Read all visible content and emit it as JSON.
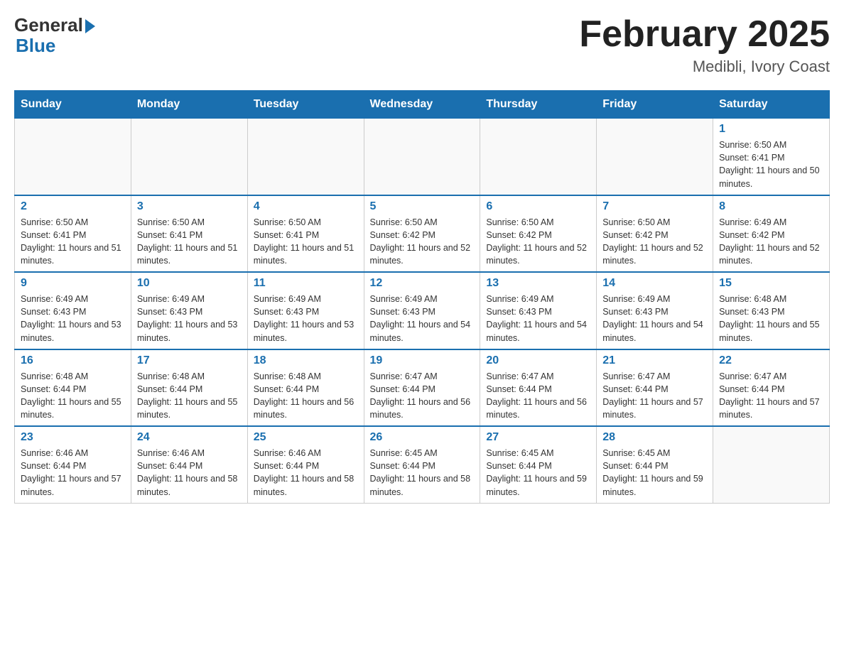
{
  "header": {
    "logo_general": "General",
    "logo_blue": "Blue",
    "title": "February 2025",
    "subtitle": "Medibli, Ivory Coast"
  },
  "days_of_week": [
    "Sunday",
    "Monday",
    "Tuesday",
    "Wednesday",
    "Thursday",
    "Friday",
    "Saturday"
  ],
  "weeks": [
    [
      {
        "day": "",
        "info": ""
      },
      {
        "day": "",
        "info": ""
      },
      {
        "day": "",
        "info": ""
      },
      {
        "day": "",
        "info": ""
      },
      {
        "day": "",
        "info": ""
      },
      {
        "day": "",
        "info": ""
      },
      {
        "day": "1",
        "info": "Sunrise: 6:50 AM\nSunset: 6:41 PM\nDaylight: 11 hours and 50 minutes."
      }
    ],
    [
      {
        "day": "2",
        "info": "Sunrise: 6:50 AM\nSunset: 6:41 PM\nDaylight: 11 hours and 51 minutes."
      },
      {
        "day": "3",
        "info": "Sunrise: 6:50 AM\nSunset: 6:41 PM\nDaylight: 11 hours and 51 minutes."
      },
      {
        "day": "4",
        "info": "Sunrise: 6:50 AM\nSunset: 6:41 PM\nDaylight: 11 hours and 51 minutes."
      },
      {
        "day": "5",
        "info": "Sunrise: 6:50 AM\nSunset: 6:42 PM\nDaylight: 11 hours and 52 minutes."
      },
      {
        "day": "6",
        "info": "Sunrise: 6:50 AM\nSunset: 6:42 PM\nDaylight: 11 hours and 52 minutes."
      },
      {
        "day": "7",
        "info": "Sunrise: 6:50 AM\nSunset: 6:42 PM\nDaylight: 11 hours and 52 minutes."
      },
      {
        "day": "8",
        "info": "Sunrise: 6:49 AM\nSunset: 6:42 PM\nDaylight: 11 hours and 52 minutes."
      }
    ],
    [
      {
        "day": "9",
        "info": "Sunrise: 6:49 AM\nSunset: 6:43 PM\nDaylight: 11 hours and 53 minutes."
      },
      {
        "day": "10",
        "info": "Sunrise: 6:49 AM\nSunset: 6:43 PM\nDaylight: 11 hours and 53 minutes."
      },
      {
        "day": "11",
        "info": "Sunrise: 6:49 AM\nSunset: 6:43 PM\nDaylight: 11 hours and 53 minutes."
      },
      {
        "day": "12",
        "info": "Sunrise: 6:49 AM\nSunset: 6:43 PM\nDaylight: 11 hours and 54 minutes."
      },
      {
        "day": "13",
        "info": "Sunrise: 6:49 AM\nSunset: 6:43 PM\nDaylight: 11 hours and 54 minutes."
      },
      {
        "day": "14",
        "info": "Sunrise: 6:49 AM\nSunset: 6:43 PM\nDaylight: 11 hours and 54 minutes."
      },
      {
        "day": "15",
        "info": "Sunrise: 6:48 AM\nSunset: 6:43 PM\nDaylight: 11 hours and 55 minutes."
      }
    ],
    [
      {
        "day": "16",
        "info": "Sunrise: 6:48 AM\nSunset: 6:44 PM\nDaylight: 11 hours and 55 minutes."
      },
      {
        "day": "17",
        "info": "Sunrise: 6:48 AM\nSunset: 6:44 PM\nDaylight: 11 hours and 55 minutes."
      },
      {
        "day": "18",
        "info": "Sunrise: 6:48 AM\nSunset: 6:44 PM\nDaylight: 11 hours and 56 minutes."
      },
      {
        "day": "19",
        "info": "Sunrise: 6:47 AM\nSunset: 6:44 PM\nDaylight: 11 hours and 56 minutes."
      },
      {
        "day": "20",
        "info": "Sunrise: 6:47 AM\nSunset: 6:44 PM\nDaylight: 11 hours and 56 minutes."
      },
      {
        "day": "21",
        "info": "Sunrise: 6:47 AM\nSunset: 6:44 PM\nDaylight: 11 hours and 57 minutes."
      },
      {
        "day": "22",
        "info": "Sunrise: 6:47 AM\nSunset: 6:44 PM\nDaylight: 11 hours and 57 minutes."
      }
    ],
    [
      {
        "day": "23",
        "info": "Sunrise: 6:46 AM\nSunset: 6:44 PM\nDaylight: 11 hours and 57 minutes."
      },
      {
        "day": "24",
        "info": "Sunrise: 6:46 AM\nSunset: 6:44 PM\nDaylight: 11 hours and 58 minutes."
      },
      {
        "day": "25",
        "info": "Sunrise: 6:46 AM\nSunset: 6:44 PM\nDaylight: 11 hours and 58 minutes."
      },
      {
        "day": "26",
        "info": "Sunrise: 6:45 AM\nSunset: 6:44 PM\nDaylight: 11 hours and 58 minutes."
      },
      {
        "day": "27",
        "info": "Sunrise: 6:45 AM\nSunset: 6:44 PM\nDaylight: 11 hours and 59 minutes."
      },
      {
        "day": "28",
        "info": "Sunrise: 6:45 AM\nSunset: 6:44 PM\nDaylight: 11 hours and 59 minutes."
      },
      {
        "day": "",
        "info": ""
      }
    ]
  ]
}
